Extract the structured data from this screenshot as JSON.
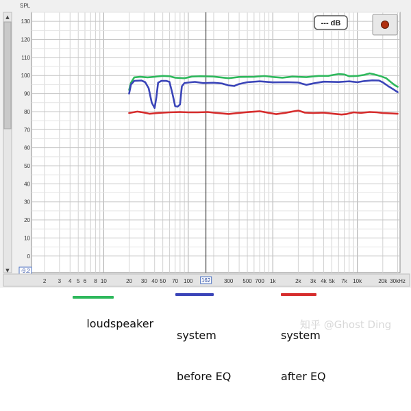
{
  "chart_data": {
    "type": "line",
    "title": "",
    "ylabel": "SPL",
    "xlabel": "",
    "x_scale": "log",
    "xlim": [
      1.4,
      32000
    ],
    "ylim": [
      -9.2,
      135
    ],
    "grid": true,
    "y_ticks": [
      130,
      120,
      110,
      100,
      90,
      80,
      70,
      60,
      50,
      40,
      30,
      20,
      10,
      0
    ],
    "y_min_label": "-9.2",
    "x_ticks": [
      {
        "v": 2,
        "label": "2"
      },
      {
        "v": 3,
        "label": "3"
      },
      {
        "v": 4,
        "label": "4"
      },
      {
        "v": 5,
        "label": "5"
      },
      {
        "v": 6,
        "label": "6"
      },
      {
        "v": 8,
        "label": "8"
      },
      {
        "v": 10,
        "label": "10"
      },
      {
        "v": 20,
        "label": "20"
      },
      {
        "v": 30,
        "label": "30"
      },
      {
        "v": 40,
        "label": "40"
      },
      {
        "v": 50,
        "label": "50"
      },
      {
        "v": 70,
        "label": "70"
      },
      {
        "v": 100,
        "label": "100"
      },
      {
        "v": 300,
        "label": "300"
      },
      {
        "v": 500,
        "label": "500"
      },
      {
        "v": 700,
        "label": "700"
      },
      {
        "v": 1000,
        "label": "1k"
      },
      {
        "v": 2000,
        "label": "2k"
      },
      {
        "v": 3000,
        "label": "3k"
      },
      {
        "v": 4000,
        "label": "4k"
      },
      {
        "v": 5000,
        "label": "5k"
      },
      {
        "v": 7000,
        "label": "7k"
      },
      {
        "v": 10000,
        "label": "10k"
      },
      {
        "v": 20000,
        "label": "20k"
      },
      {
        "v": 30000,
        "label": "30kHz"
      }
    ],
    "cursor": {
      "x": 162,
      "label": "162"
    },
    "readout_button": "--- dB",
    "series": [
      {
        "name": "loudspeaker",
        "color": "#2eb85c",
        "points": [
          [
            20,
            92
          ],
          [
            21,
            96
          ],
          [
            23,
            99
          ],
          [
            27,
            99.3
          ],
          [
            33,
            99
          ],
          [
            40,
            99.3
          ],
          [
            50,
            99.8
          ],
          [
            60,
            99.6
          ],
          [
            70,
            98.8
          ],
          [
            90,
            98.5
          ],
          [
            110,
            99.4
          ],
          [
            140,
            99.6
          ],
          [
            200,
            99.4
          ],
          [
            300,
            98.5
          ],
          [
            400,
            99.2
          ],
          [
            600,
            99.3
          ],
          [
            800,
            99.7
          ],
          [
            1000,
            99.2
          ],
          [
            1300,
            98.8
          ],
          [
            1700,
            99.4
          ],
          [
            2500,
            99.1
          ],
          [
            3500,
            99.8
          ],
          [
            4500,
            99.8
          ],
          [
            5200,
            100.3
          ],
          [
            6000,
            100.8
          ],
          [
            7000,
            100.6
          ],
          [
            8000,
            99.6
          ],
          [
            10000,
            99.8
          ],
          [
            12000,
            100.3
          ],
          [
            14000,
            101.2
          ],
          [
            16000,
            100.6
          ],
          [
            19000,
            99.6
          ],
          [
            22000,
            98.5
          ],
          [
            25000,
            96.3
          ],
          [
            28000,
            94.5
          ],
          [
            30000,
            93.8
          ]
        ]
      },
      {
        "name": "system before EQ",
        "color": "#3a44b8",
        "points": [
          [
            20,
            90
          ],
          [
            21,
            95
          ],
          [
            23,
            97
          ],
          [
            28,
            97.2
          ],
          [
            31,
            96.3
          ],
          [
            34,
            93
          ],
          [
            37,
            85
          ],
          [
            40,
            82
          ],
          [
            42,
            88
          ],
          [
            44,
            96
          ],
          [
            48,
            97
          ],
          [
            55,
            97
          ],
          [
            60,
            96.5
          ],
          [
            65,
            90
          ],
          [
            70,
            83
          ],
          [
            75,
            82.8
          ],
          [
            80,
            84
          ],
          [
            84,
            94
          ],
          [
            90,
            95.8
          ],
          [
            100,
            96.1
          ],
          [
            120,
            96.5
          ],
          [
            150,
            95.8
          ],
          [
            200,
            96
          ],
          [
            250,
            95.6
          ],
          [
            300,
            94.5
          ],
          [
            350,
            94.2
          ],
          [
            400,
            95.3
          ],
          [
            500,
            96.3
          ],
          [
            700,
            96.8
          ],
          [
            1000,
            96.2
          ],
          [
            1500,
            96.3
          ],
          [
            2000,
            96.1
          ],
          [
            2500,
            94.8
          ],
          [
            3000,
            95.6
          ],
          [
            4000,
            96.6
          ],
          [
            6000,
            96.4
          ],
          [
            8000,
            96.8
          ],
          [
            10000,
            96.3
          ],
          [
            12000,
            96.9
          ],
          [
            15000,
            97.3
          ],
          [
            18000,
            97.2
          ],
          [
            20000,
            96.2
          ],
          [
            23000,
            94.2
          ],
          [
            27000,
            92.2
          ],
          [
            30000,
            90.8
          ]
        ]
      },
      {
        "name": "system after EQ",
        "color": "#d62c2c",
        "points": [
          [
            20,
            79.2
          ],
          [
            25,
            80
          ],
          [
            30,
            79.5
          ],
          [
            35,
            78.8
          ],
          [
            45,
            79.3
          ],
          [
            60,
            79.6
          ],
          [
            80,
            79.8
          ],
          [
            100,
            79.6
          ],
          [
            130,
            79.6
          ],
          [
            170,
            79.8
          ],
          [
            200,
            79.4
          ],
          [
            250,
            79
          ],
          [
            300,
            78.7
          ],
          [
            400,
            79.3
          ],
          [
            500,
            79.7
          ],
          [
            700,
            80.2
          ],
          [
            900,
            79.3
          ],
          [
            1100,
            78.6
          ],
          [
            1400,
            79.3
          ],
          [
            1700,
            80
          ],
          [
            2000,
            80.6
          ],
          [
            2400,
            79.4
          ],
          [
            3000,
            79.2
          ],
          [
            4000,
            79.4
          ],
          [
            5000,
            78.9
          ],
          [
            6500,
            78.4
          ],
          [
            7500,
            78.7
          ],
          [
            9000,
            79.6
          ],
          [
            11000,
            79.3
          ],
          [
            14000,
            79.8
          ],
          [
            17000,
            79.6
          ],
          [
            20000,
            79.2
          ],
          [
            25000,
            79
          ],
          [
            30000,
            78.8
          ]
        ]
      }
    ],
    "legend": [
      {
        "lines": [
          "loudspeaker"
        ],
        "color": "#2eb85c"
      },
      {
        "lines": [
          "system",
          "before EQ"
        ],
        "color": "#3a44b8"
      },
      {
        "lines": [
          "system",
          "after EQ"
        ],
        "color": "#d62c2c"
      }
    ],
    "watermark": "知乎 @Ghost Ding"
  }
}
